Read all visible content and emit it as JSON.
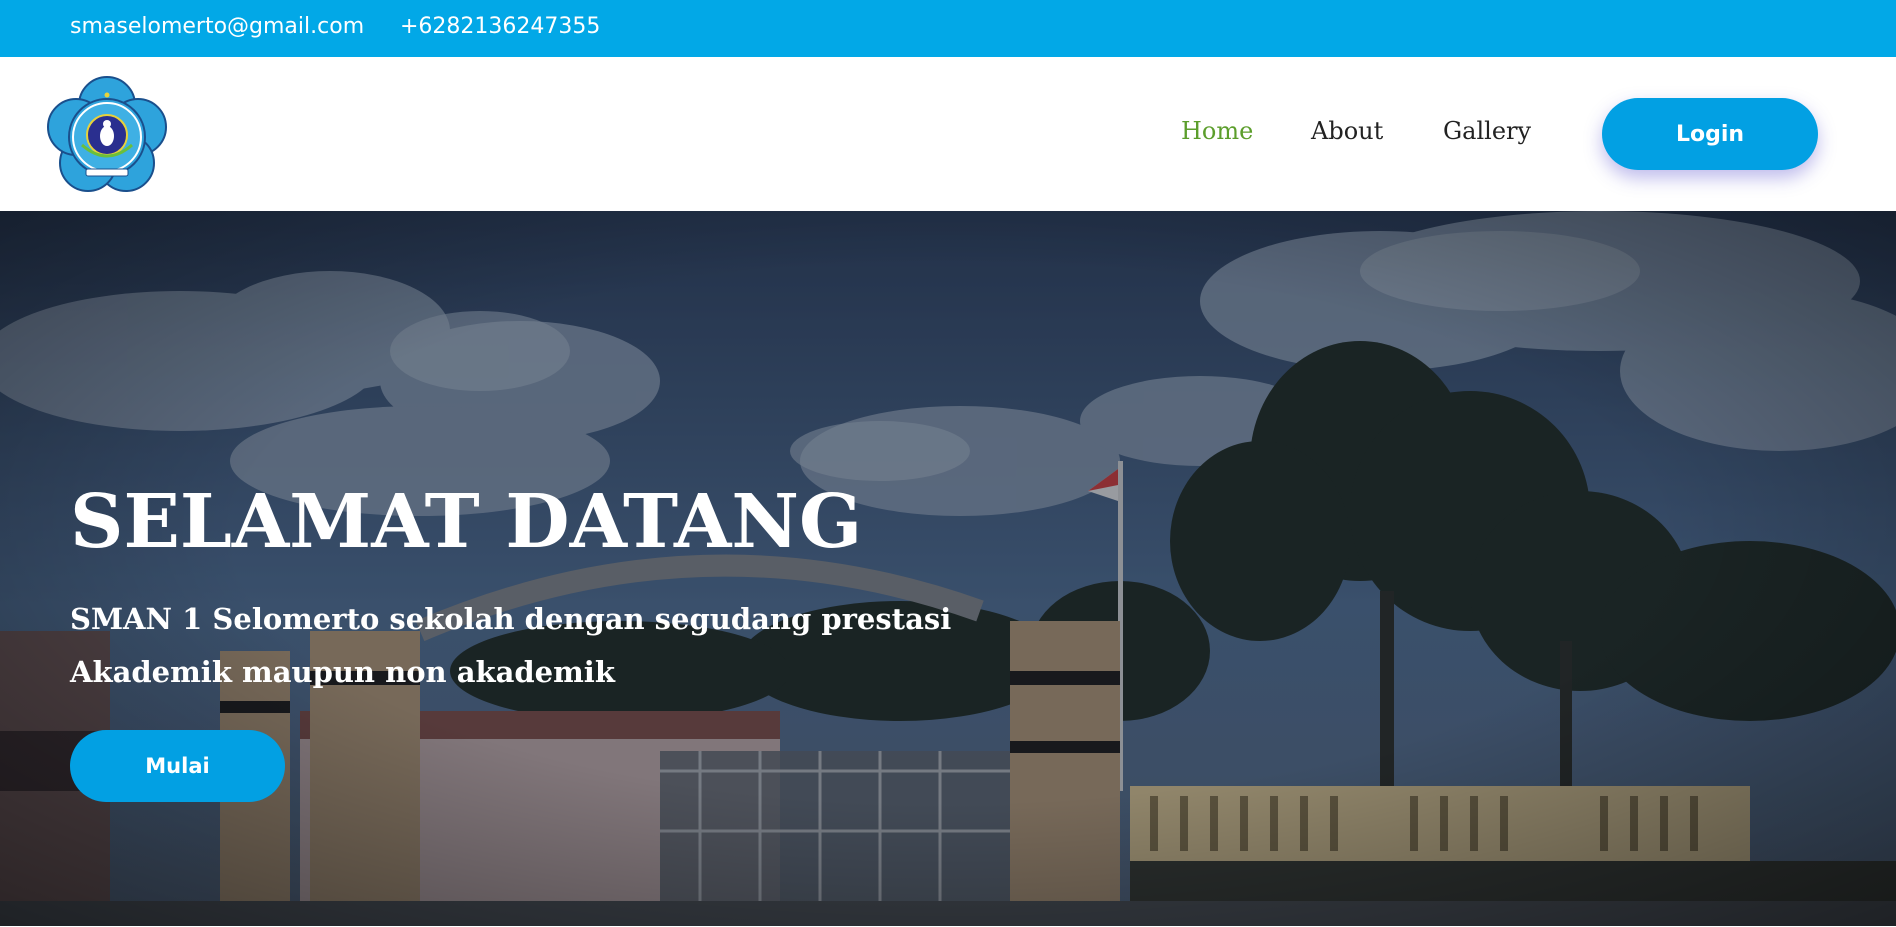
{
  "topbar": {
    "email": "smaselomerto@gmail.com",
    "phone": "+6282136247355"
  },
  "header": {
    "logo_icon": "school-emblem-icon",
    "nav": {
      "home": "Home",
      "about": "About",
      "gallery": "Gallery"
    },
    "login_label": "Login",
    "active_nav": "Home"
  },
  "hero": {
    "title": "SELAMAT DATANG",
    "subtitle_line1": "SMAN 1 Selomerto sekolah dengan segudang prestasi",
    "subtitle_line2": "Akademik maupun non akademik",
    "cta_label": "Mulai"
  },
  "colors": {
    "topbar_bg": "#02a8e7",
    "accent": "#02a0e3",
    "nav_active": "#5c9e2c",
    "nav_text": "#222222"
  }
}
